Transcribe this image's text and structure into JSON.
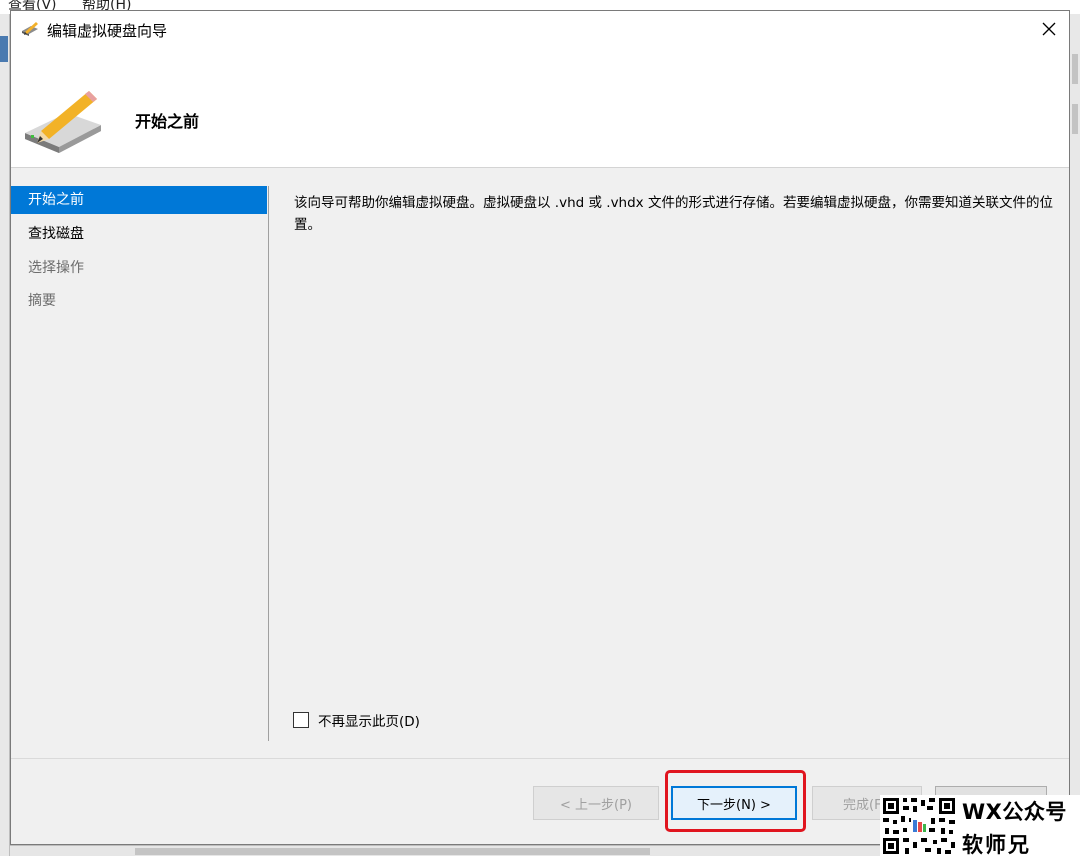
{
  "background": {
    "menu": [
      "查看(V)",
      "帮助(H)"
    ]
  },
  "dialog": {
    "title": "编辑虚拟硬盘向导",
    "header_title": "开始之前",
    "nav": [
      {
        "label": "开始之前",
        "state": "active"
      },
      {
        "label": "查找磁盘",
        "state": "enabled"
      },
      {
        "label": "选择操作",
        "state": "disabled"
      },
      {
        "label": "摘要",
        "state": "disabled"
      }
    ],
    "description": "该向导可帮助你编辑虚拟硬盘。虚拟硬盘以 .vhd 或 .vhdx 文件的形式进行存储。若要编辑虚拟硬盘，你需要知道关联文件的位置。",
    "checkbox": {
      "label": "不再显示此页(D)",
      "checked": false
    },
    "buttons": {
      "prev": "< 上一步(P)",
      "next": "下一步(N) >",
      "finish": "完成(F)",
      "cancel": ""
    }
  },
  "watermark": {
    "line1": "WX公众号",
    "line2": "软师兄"
  },
  "colors": {
    "accent": "#0078d7",
    "highlight": "#e0141e"
  }
}
